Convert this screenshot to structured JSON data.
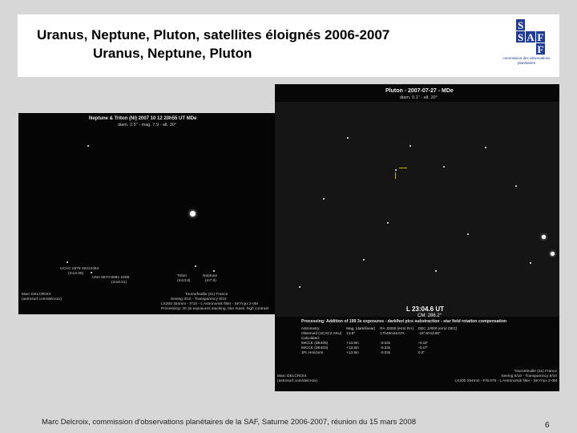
{
  "header": {
    "title_line1": "Uranus, Neptune, Pluton, satellites éloignés 2006-2007",
    "title_line2": "Uranus, Neptune, Pluton",
    "logo_letters": [
      "S",
      "",
      "",
      "S",
      "A",
      "F",
      "",
      "",
      "F"
    ],
    "logo_caption": "commission des observations planétaires"
  },
  "neptune_photo": {
    "title": "Neptune & Triton (Nl) 2007 10 12 20h55 UT MDe",
    "subtitle": "diam. 2.5'' - mag. 7.9 - alt. 30°",
    "star_label_1": "UCAC 2879 30412464",
    "star_label_1b": "(m13.09)",
    "star_label_2": "UNA 5670-0681 2208",
    "star_label_2b": "(m16.51)",
    "triton_label": "Triton",
    "triton_mag": "(m13.8)",
    "neptune_label": "Neptune",
    "neptune_mag": "(m7.9)",
    "credit_left_1": "Marc DELCROIX",
    "credit_left_2": "(astrosurf.com/delcroix)",
    "credit_right_1": "Tournefeuille (31) France",
    "credit_right_2": "Seeing 3/10 - Transparency 8/10",
    "credit_right_3": "LX200 254mm - F/10 - L Astronomik filter - SKYnyx 2-0M",
    "credit_right_4": "Processing: 30 3s exposures stacking, blur mask, high contrast"
  },
  "pluton_photo": {
    "title": "Pluton - 2007-07-27 - MDe",
    "subtitle": "diam. 0.1'' - alt. 20°",
    "time": "L 23:04.6 UT",
    "cn": "CM: 286.2°",
    "processing": "Processing: Addition of 199 3s exposures - dark/hot pics substraction - star field rotation compensation",
    "table": [
      [
        "Astrometry:",
        "Mag. (dark/linear)",
        "RA J2000 (error RA)",
        "DEC J2000 (error DEC)"
      ],
      [
        "Observed (UCAC2 ASU)",
        "13.8*",
        "17h49m46.67s",
        "-16°40'43.95\""
      ],
      [
        "Calculated:",
        "",
        "",
        ""
      ],
      [
        "IMCCE (DE405)",
        "+13.8m",
        "-0.02s",
        "-0.33\""
      ],
      [
        "IMCCE (DE403)",
        "+13.8m",
        "-0.03s",
        "-0.47\""
      ],
      [
        "JPL Horizons",
        "+13.8m",
        "-0.03s",
        "0.0\""
      ]
    ],
    "credit_left_1": "Marc DELCROIX",
    "credit_left_2": "(astrosurf.com/delcroix)",
    "credit_right_1": "Tournefeuille (31) France",
    "credit_right_2": "Seeing 5/10 - Transparency 8/10",
    "credit_right_3": "LX200 254mm - F/6.075 - L Astronomik filter - SKYnyx 2-0M"
  },
  "footer": {
    "text": "Marc Delcroix, commission d'observations planétaires de la SAF, Saturne 2006-2007, réunion du 15 mars 2008",
    "page_number": "6"
  }
}
